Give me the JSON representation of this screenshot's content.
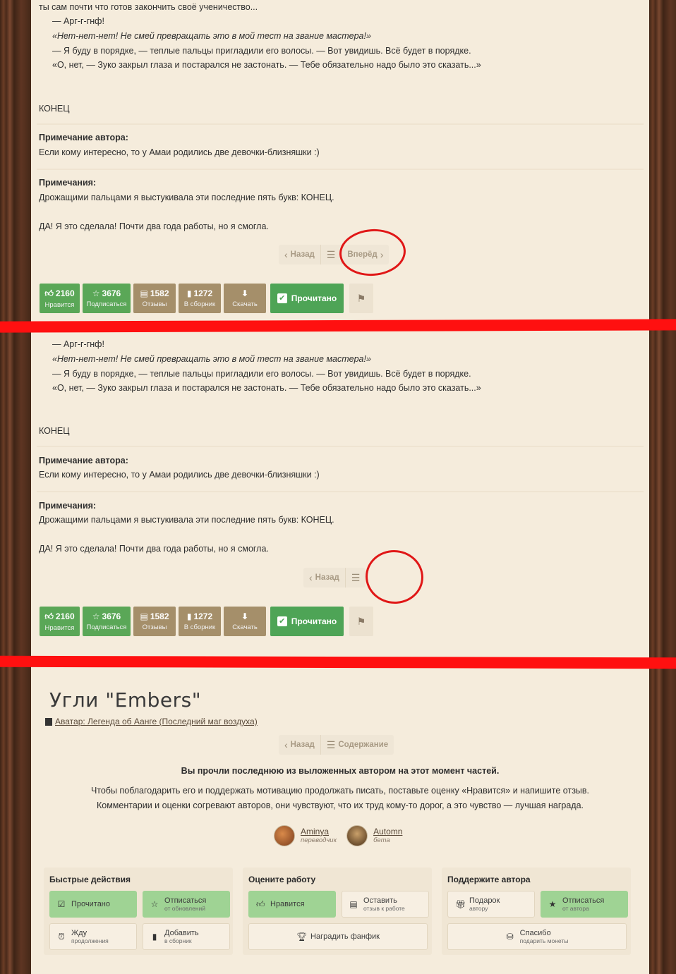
{
  "story": {
    "lines": [
      "ты сам почти что готов закончить своё ученичество...",
      "— Арг-г-гнф!",
      "«Нет-нет-нет! Не смей превращать это в мой тест на звание мастера!»",
      "— Я буду в порядке, — теплые пальцы пригладили его волосы. — Вот увидишь. Всё будет в порядке.",
      "«О, нет, — Зуко закрыл глаза и постарался не застонать. — Тебе обязательно надо было это сказать...»"
    ],
    "end": "КОНЕЦ",
    "author_note_title": "Примечание автора:",
    "author_note_text": "Если кому интересно, то у Амаи родились две девочки-близняшки :)",
    "notes_title": "Примечания:",
    "notes_text1": "Дрожащими пальцами я выстукивала эти последние пять букв: КОНЕЦ.",
    "notes_text2": "ДА! Я это сделала! Почти два года работы, но я смогла."
  },
  "pager": {
    "back": "Назад",
    "forward": "Вперёд",
    "contents": "Содержание"
  },
  "actions": {
    "likes": "2160",
    "likes_label": "Нравится",
    "subs": "3676",
    "subs_label": "Подписаться",
    "reviews": "1582",
    "reviews_label": "Отзывы",
    "collections": "1272",
    "collections_label": "В сборник",
    "download_label": "Скачать",
    "read_label": "Прочитано"
  },
  "footer": {
    "title": "Угли \"Embers\"",
    "fandom": "Аватар: Легенда об Аанге (Последний маг воздуха)",
    "finished_msg": "Вы прочли последнюю из выложенных автором на этот момент частей.",
    "thanks_1": "Чтобы поблагодарить его и поддержать мотивацию продолжать писать, поставьте оценку «Нравится» и напишите отзыв.",
    "thanks_2": "Комментарии и оценки согревают авторов, они чувствуют, что их труд кому-то дорог, а это чувство — лучшая награда.",
    "authors": [
      {
        "name": "Aminya",
        "role": "переводчик"
      },
      {
        "name": "Automn",
        "role": "бета"
      }
    ]
  },
  "cards": {
    "quick": {
      "title": "Быстрые действия",
      "read": "Прочитано",
      "unsub_1": "Отписаться",
      "unsub_2": "от обновлений",
      "wait_1": "Жду",
      "wait_2": "продолжения",
      "add_1": "Добавить",
      "add_2": "в сборник"
    },
    "rate": {
      "title": "Оцените работу",
      "like": "Нравится",
      "review_1": "Оставить",
      "review_2": "отзыв к работе",
      "reward": "Наградить фанфик"
    },
    "support": {
      "title": "Поддержите автора",
      "gift_1": "Подарок",
      "gift_2": "автору",
      "unsub_1": "Отписаться",
      "unsub_2": "от автора",
      "thanks_1": "Спасибо",
      "thanks_2": "подарить монеты"
    }
  },
  "colors": {
    "green": "#5aa757",
    "brown": "#a58f6a",
    "annotation_red": "#ff1010",
    "paper": "#f5ecdc"
  }
}
